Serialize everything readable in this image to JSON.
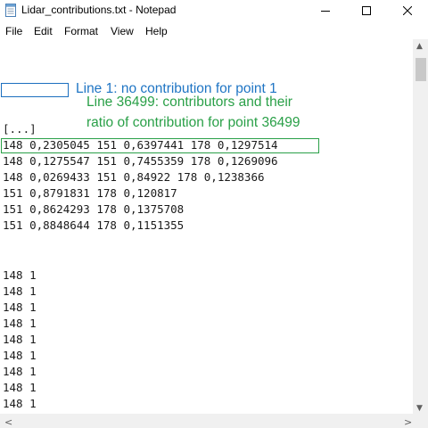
{
  "window": {
    "title": "Lidar_contributions.txt - Notepad",
    "minimize_glyph": "—",
    "maximize_glyph": "☐",
    "close_glyph": "✕"
  },
  "menu": {
    "items": [
      "File",
      "Edit",
      "Format",
      "View",
      "Help"
    ]
  },
  "annotations": {
    "line1": "Line 1: no contribution for point 1",
    "line36499_a": "Line 36499: contributors and their",
    "line36499_b": "ratio of contribution for point 36499"
  },
  "editor": {
    "lines": [
      "[...]",
      "148 0,2305045 151 0,6397441 178 0,1297514",
      "148 0,1275547 151 0,7455359 178 0,1269096",
      "148 0,0269433 151 0,84922 178 0,1238366",
      "151 0,8791831 178 0,120817",
      "151 0,8624293 178 0,1375708",
      "151 0,8848644 178 0,1151355",
      "",
      "",
      "148 1",
      "148 1",
      "148 1",
      "148 1",
      "148 1",
      "148 1",
      "148 1",
      "148 1",
      "148 1"
    ]
  },
  "scrollbar": {
    "up_glyph": "▲",
    "down_glyph": "▼",
    "left_glyph": "<",
    "right_glyph": ">"
  },
  "colors": {
    "annotation_blue": "#1f75c4",
    "annotation_green": "#2aa048"
  },
  "icons": [
    "notepad-icon",
    "minimize-icon",
    "maximize-icon",
    "close-icon"
  ]
}
